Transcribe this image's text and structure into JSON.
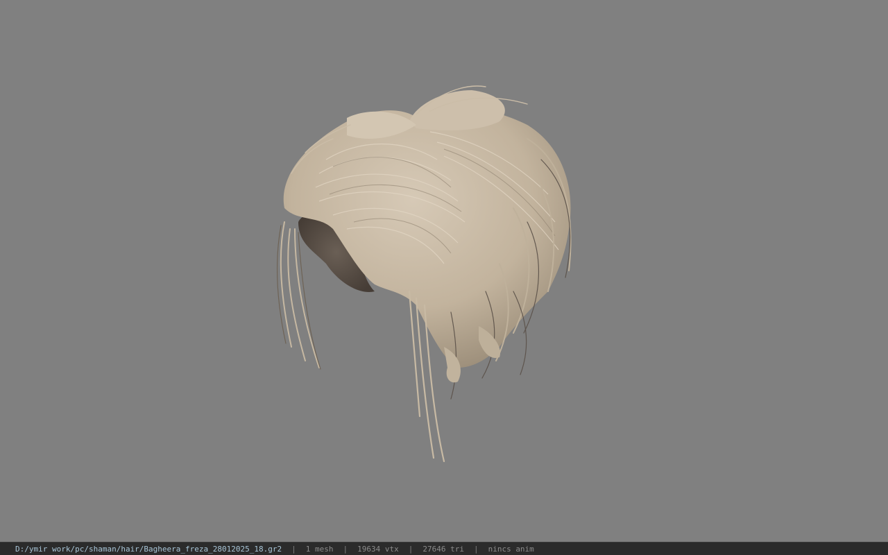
{
  "viewport": {
    "background_color": "#808080",
    "model": "hair-mesh",
    "hair_color": "#c8b9a4",
    "shadow_color": "#5a5048"
  },
  "statusbar": {
    "file_path": "D:/ymir work/pc/shaman/hair/Bagheera_freza_28012025_18.gr2",
    "separator": "|",
    "mesh_count": "1 mesh",
    "vertex_count": "19634 vtx",
    "triangle_count": "27646 tri",
    "anim_status": "nincs anim"
  }
}
